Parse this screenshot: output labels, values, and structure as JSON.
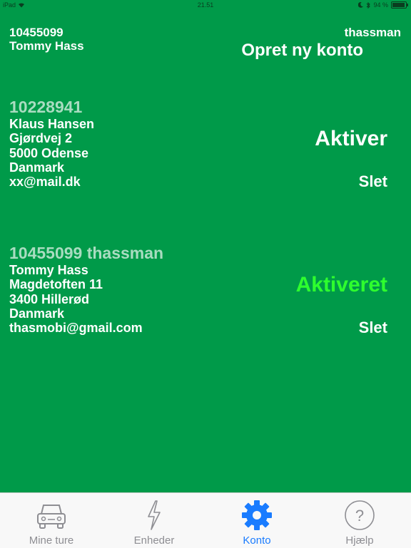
{
  "status_bar": {
    "device": "iPad",
    "time": "21.51",
    "battery": "94 %",
    "battery_level": 0.94
  },
  "current_account": {
    "number": "10455099",
    "name": "Tommy Hass",
    "username": "thassman",
    "create_label": "Opret ny konto"
  },
  "accounts": [
    {
      "heading": "10228941",
      "lines": [
        "Klaus Hansen",
        "Gjørdvej 2",
        "5000 Odense",
        "Danmark",
        "xx@mail.dk"
      ],
      "status_label": "Aktiver",
      "delete_label": "Slet"
    },
    {
      "heading": "10455099 thassman",
      "lines": [
        "Tommy Hass",
        "Magdetoften 11",
        "3400 Hillerød",
        "Danmark",
        "thasmobi@gmail.com"
      ],
      "status_label": "Aktiveret",
      "delete_label": "Slet"
    }
  ],
  "tabs": [
    {
      "label": "Mine ture",
      "icon": "car-icon"
    },
    {
      "label": "Enheder",
      "icon": "lightning-icon"
    },
    {
      "label": "Konto",
      "icon": "gear-icon",
      "selected": true
    },
    {
      "label": "Hjælp",
      "icon": "help-icon"
    }
  ],
  "colors": {
    "background": "#009a49",
    "tab_selected": "#1a7cff",
    "active_status": "#2eff2e"
  }
}
